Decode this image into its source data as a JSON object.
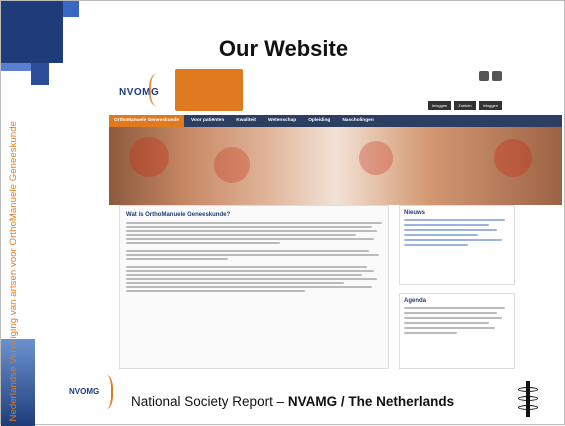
{
  "slide": {
    "title": "Our Website",
    "side_text": "Nederlandse Vereniging van artsen voor OrthoManuele Geneeskunde",
    "footer_prefix": "National Society Report – ",
    "footer_bold": "NVAMG / The Netherlands"
  },
  "website": {
    "logo_text": "NVOMG",
    "nav": [
      "OrthoManuele Geneeskunde",
      "Voor patiënten",
      "Kwaliteit",
      "Wetenschap",
      "Opleiding",
      "Nascholingen"
    ],
    "util": [
      "Inloggen",
      "Zoeken",
      "Inloggen"
    ],
    "main_heading": "Wat is OrthoManuele Geneeskunde?",
    "news_heading": "Nieuws",
    "agenda_heading": "Agenda"
  },
  "footer_logo_text": "NVOMG",
  "colors": {
    "accent": "#e07a1f",
    "brand": "#1f3c7a",
    "nav": "#2d3e63"
  }
}
